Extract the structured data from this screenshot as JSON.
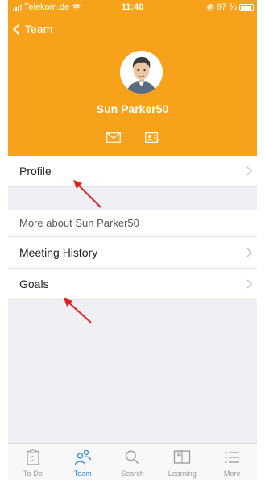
{
  "status_bar": {
    "carrier": "Telekom.de",
    "time": "11:46",
    "battery": "97 %"
  },
  "nav": {
    "back_label": "Team"
  },
  "profile": {
    "name": "Sun Parker50"
  },
  "rows": {
    "profile": "Profile",
    "section_header": "More about Sun Parker50",
    "meeting_history": "Meeting History",
    "goals": "Goals"
  },
  "tabs": [
    {
      "label": "To-Do",
      "icon": "todo-icon",
      "active": false
    },
    {
      "label": "Team",
      "icon": "team-icon",
      "active": true
    },
    {
      "label": "Search",
      "icon": "search-icon",
      "active": false
    },
    {
      "label": "Learning",
      "icon": "learning-icon",
      "active": false
    },
    {
      "label": "More",
      "icon": "menu-icon",
      "active": false
    }
  ],
  "colors": {
    "accent": "#f7a21a",
    "tab_active": "#2a8bd1",
    "annotation_arrow": "#e02020"
  }
}
